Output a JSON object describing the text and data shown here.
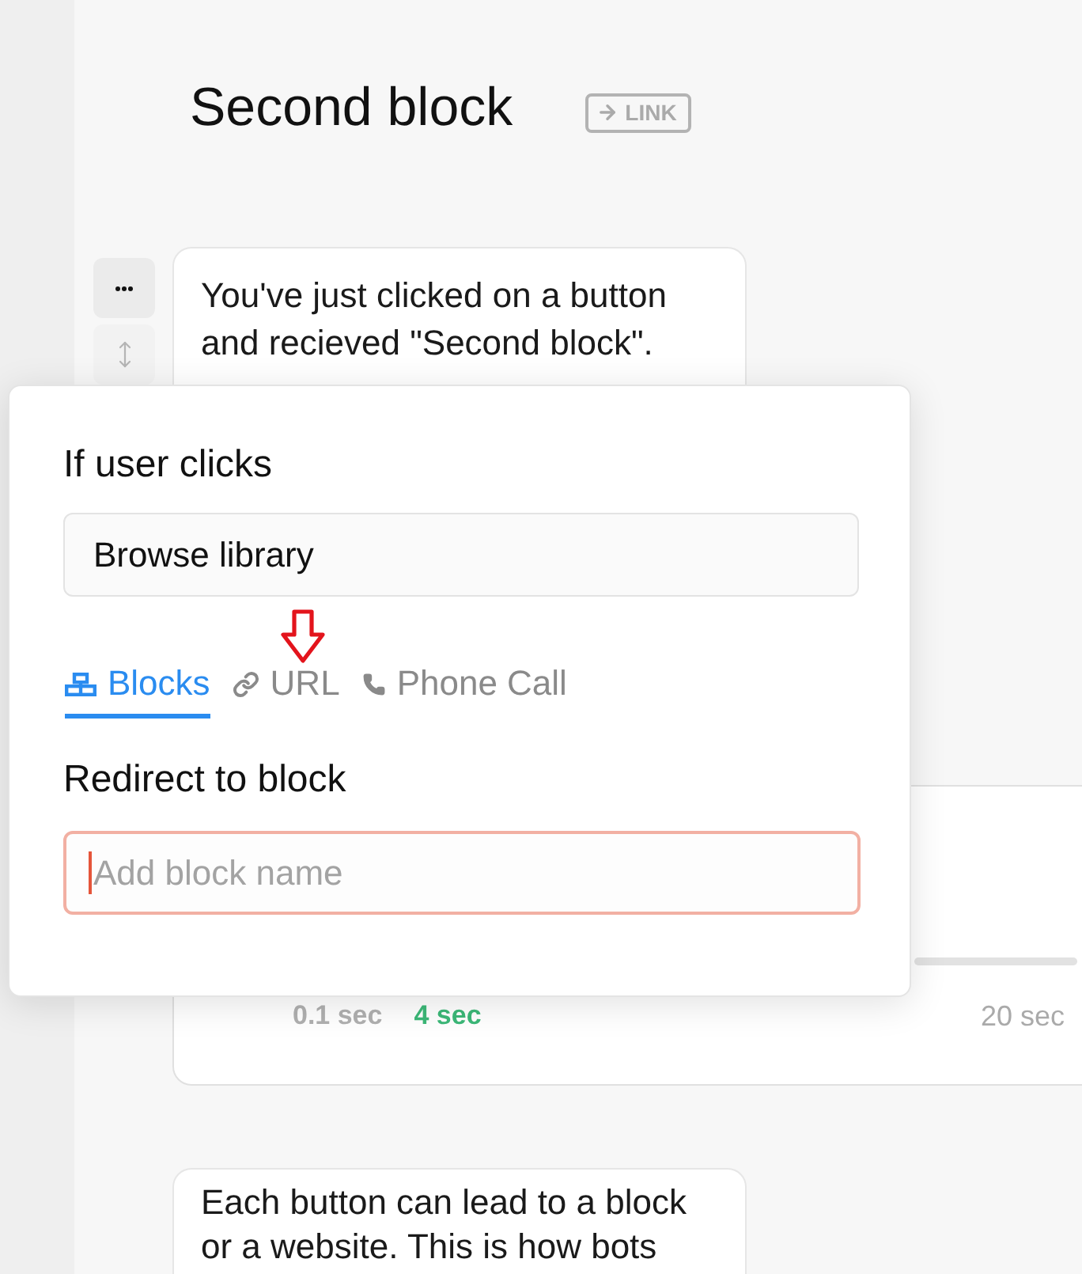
{
  "block": {
    "title": "Second block",
    "badge": "LINK"
  },
  "cards": [
    {
      "kind": "text",
      "handles": true,
      "text": "You've just clicked on a button and recieved \"Second block\"."
    },
    {
      "kind": "delay",
      "min_label": "0.1 sec",
      "value_label": "4 sec",
      "max_label": "20 sec"
    },
    {
      "kind": "text",
      "text": "Each button can lead to a block or a website. This is how bots"
    }
  ],
  "popover": {
    "title": "If user clicks",
    "button_field": {
      "value": "Browse library"
    },
    "tabs": [
      {
        "kind": "blocks",
        "label": "Blocks",
        "selected": true
      },
      {
        "kind": "url",
        "label": "URL",
        "selected": false
      },
      {
        "kind": "phone",
        "label": "Phone Call",
        "selected": false
      }
    ],
    "section_label": "Redirect to block",
    "block_field": {
      "placeholder": "Add block name",
      "focused": true
    }
  }
}
